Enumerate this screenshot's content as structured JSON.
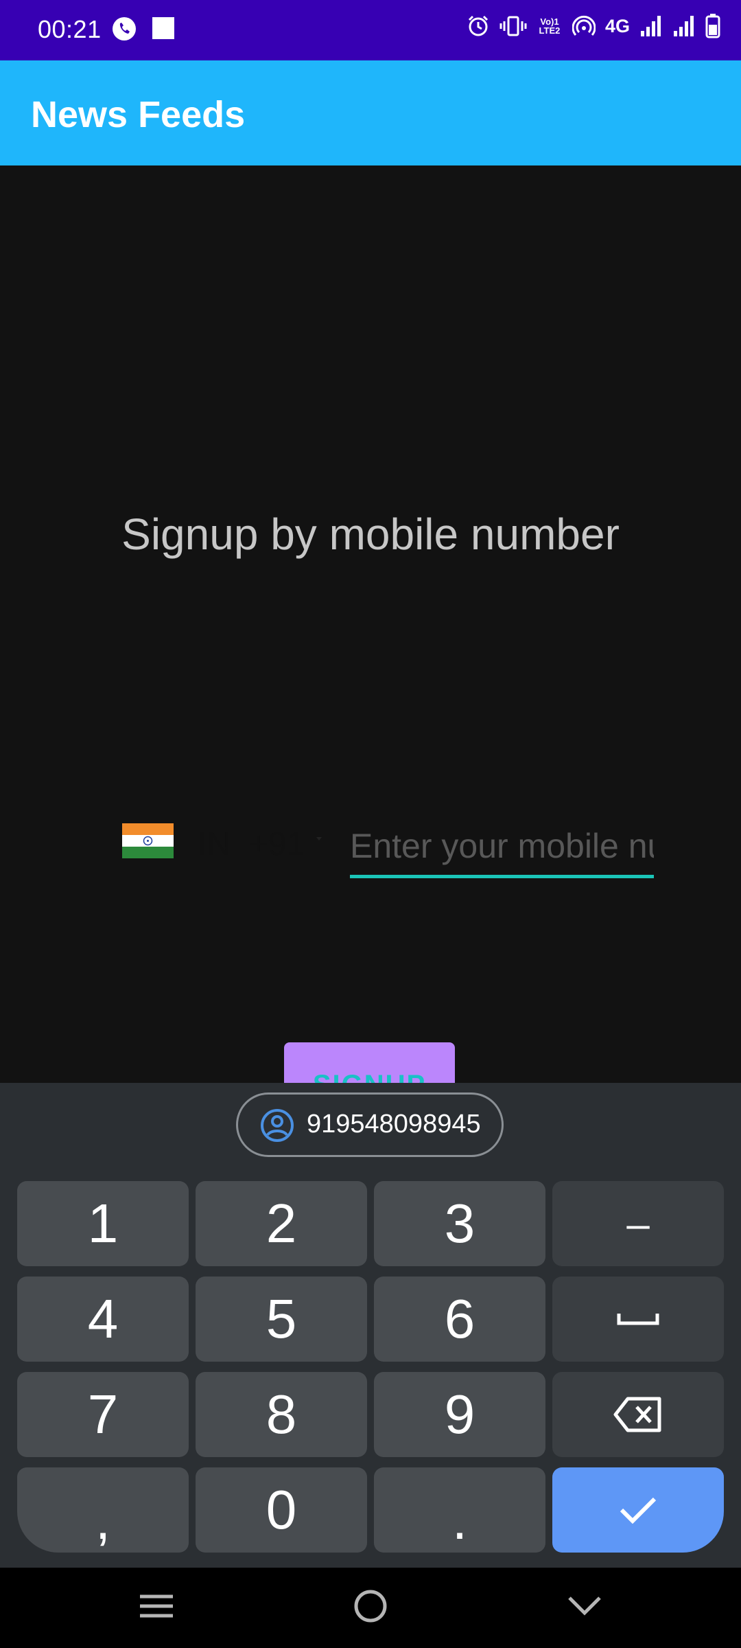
{
  "status_bar": {
    "time": "00:21",
    "network": "4G",
    "volte": "Vo) LTE2"
  },
  "app_bar": {
    "title": "News Feeds"
  },
  "content": {
    "headline": "Signup by mobile number",
    "country_iso": "IN",
    "dial_code": "+91",
    "phone_placeholder": "Enter your mobile number",
    "signup_label": "SIGNUP"
  },
  "keyboard": {
    "suggestion": "919548098945",
    "rows": [
      [
        "1",
        "2",
        "3",
        "–"
      ],
      [
        "4",
        "5",
        "6",
        "␣"
      ],
      [
        "7",
        "8",
        "9",
        "⌫"
      ],
      [
        ",",
        "0",
        ".",
        "✓"
      ]
    ]
  },
  "colors": {
    "status_bar": "#3700b3",
    "app_bar": "#1fb6fb",
    "accent_underline": "#1bc5b8",
    "signup_button": "#bb86fc",
    "enter_key": "#5e97f6"
  }
}
